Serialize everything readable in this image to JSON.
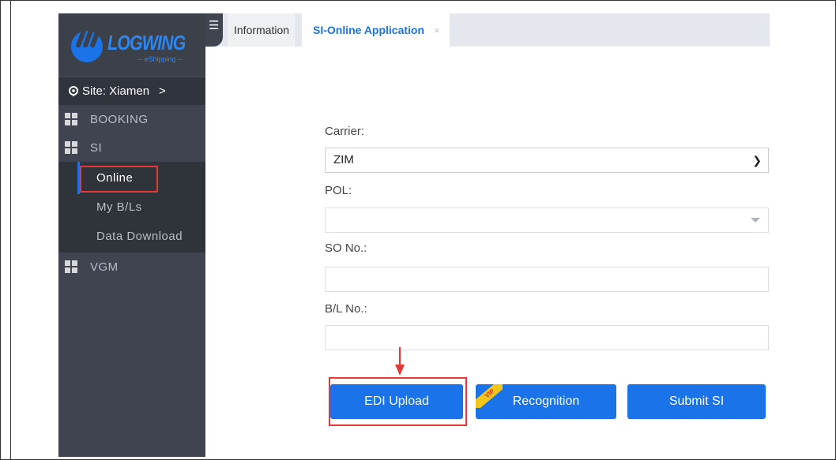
{
  "logo": {
    "text": "LOGWING",
    "subtext": "-- eShipping --"
  },
  "site": {
    "label": "Site: Xiamen",
    "chevron": ">"
  },
  "sidebar": {
    "items": [
      {
        "label": "BOOKING",
        "icon": "grid-icon"
      },
      {
        "label": "SI",
        "icon": "grid-icon",
        "children": [
          {
            "label": "Online",
            "active": true
          },
          {
            "label": "My B/Ls"
          },
          {
            "label": "Data Download"
          }
        ]
      },
      {
        "label": "VGM",
        "icon": "grid-icon"
      }
    ]
  },
  "tabs": [
    {
      "label": "Information"
    },
    {
      "label": "SI-Online Application",
      "active": true,
      "close": "×"
    }
  ],
  "form": {
    "carrier_label": "Carrier:",
    "carrier_value": "ZIM",
    "pol_label": "POL:",
    "pol_value": "",
    "so_label": "SO No.:",
    "so_value": "",
    "bl_label": "B/L No.:",
    "bl_value": ""
  },
  "buttons": {
    "edi_upload": "EDI Upload",
    "recognition": "Recognition",
    "recognition_badge": "VIP",
    "submit": "Submit SI"
  },
  "colors": {
    "accent": "#1a73e8",
    "sidebar": "#3f4450",
    "highlight": "#e53935"
  }
}
